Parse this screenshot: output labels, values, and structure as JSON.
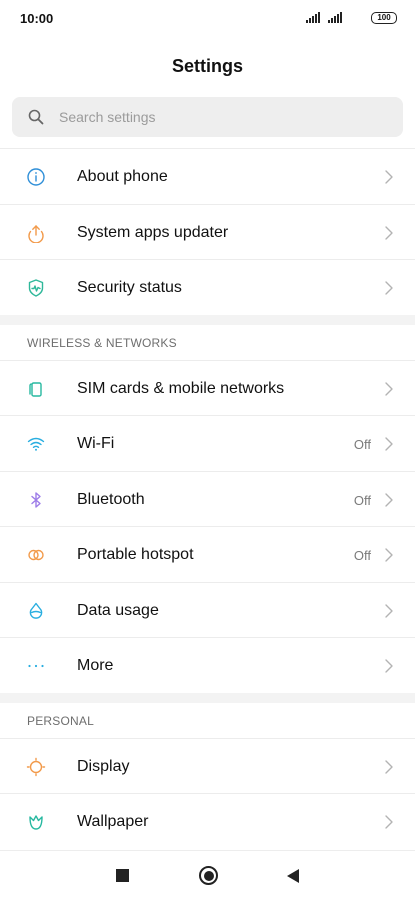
{
  "status_bar": {
    "time": "10:00",
    "battery": "100"
  },
  "header": {
    "title": "Settings"
  },
  "search": {
    "placeholder": "Search settings"
  },
  "groups": [
    {
      "header": "",
      "items": [
        {
          "label": "About phone",
          "value": "",
          "icon": "info-icon",
          "color": "#2f8fd8"
        },
        {
          "label": "System apps updater",
          "value": "",
          "icon": "update-arrow-icon",
          "color": "#f29a4a"
        },
        {
          "label": "Security status",
          "value": "",
          "icon": "shield-icon",
          "color": "#2fb89a"
        }
      ]
    },
    {
      "header": "WIRELESS & NETWORKS",
      "items": [
        {
          "label": "SIM cards & mobile networks",
          "value": "",
          "icon": "sim-card-icon",
          "color": "#27b8a0"
        },
        {
          "label": "Wi-Fi",
          "value": "Off",
          "icon": "wifi-icon",
          "color": "#29aee0"
        },
        {
          "label": "Bluetooth",
          "value": "Off",
          "icon": "bluetooth-icon",
          "color": "#9d7ce8"
        },
        {
          "label": "Portable hotspot",
          "value": "Off",
          "icon": "hotspot-icon",
          "color": "#f29a4a"
        },
        {
          "label": "Data usage",
          "value": "",
          "icon": "data-drop-icon",
          "color": "#29aee0"
        },
        {
          "label": "More",
          "value": "",
          "icon": "more-dots-icon",
          "color": "#29aee0"
        }
      ]
    },
    {
      "header": "PERSONAL",
      "items": [
        {
          "label": "Display",
          "value": "",
          "icon": "brightness-icon",
          "color": "#f29a4a"
        },
        {
          "label": "Wallpaper",
          "value": "",
          "icon": "wallpaper-icon",
          "color": "#27b8a0"
        }
      ]
    }
  ],
  "nav": {
    "recent": "recent-apps-icon",
    "home": "home-icon",
    "back": "back-icon"
  }
}
